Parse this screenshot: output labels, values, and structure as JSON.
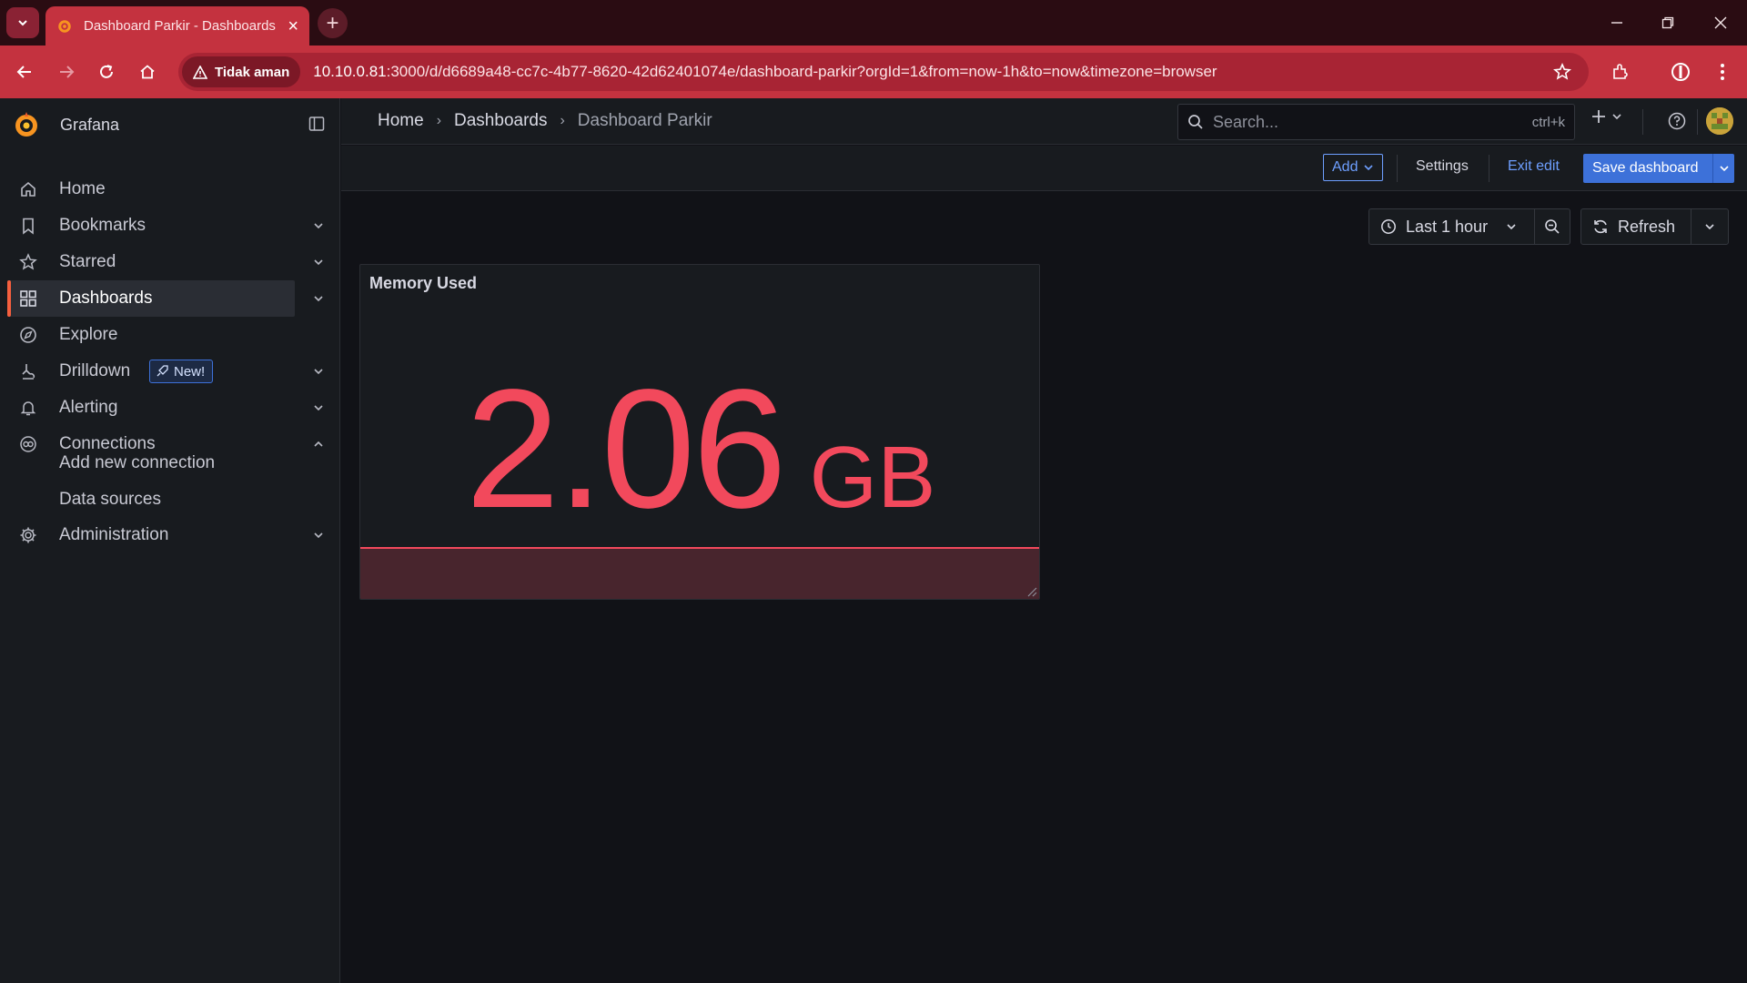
{
  "browser": {
    "tab_title": "Dashboard Parkir - Dashboards - Grafana",
    "security_label": "Tidak aman",
    "url_host": "10.10.0.81",
    "url_rest": ":3000/d/d6689a48-cc7c-4b77-8620-42d62401074e/dashboard-parkir?orgId=1&from=now-1h&to=now&timezone=browser"
  },
  "app": {
    "name": "Grafana"
  },
  "sidebar": {
    "items": [
      {
        "label": "Home",
        "icon": "home-icon"
      },
      {
        "label": "Bookmarks",
        "icon": "bookmark-icon"
      },
      {
        "label": "Starred",
        "icon": "star-icon"
      },
      {
        "label": "Dashboards",
        "icon": "apps-icon"
      },
      {
        "label": "Explore",
        "icon": "compass-icon"
      },
      {
        "label": "Drilldown",
        "icon": "drilldown-icon",
        "badge": "New!"
      },
      {
        "label": "Alerting",
        "icon": "bell-icon"
      },
      {
        "label": "Connections",
        "icon": "connections-icon"
      },
      {
        "label": "Administration",
        "icon": "gear-icon"
      }
    ],
    "connections_sub": [
      "Add new connection",
      "Data sources"
    ]
  },
  "breadcrumb": [
    "Home",
    "Dashboards",
    "Dashboard Parkir"
  ],
  "search": {
    "placeholder": "Search...",
    "shortcut": "ctrl+k"
  },
  "editbar": {
    "add_label": "Add",
    "settings_label": "Settings",
    "exit_label": "Exit edit",
    "save_label": "Save dashboard"
  },
  "controls": {
    "time_range": "Last 1 hour",
    "refresh_label": "Refresh"
  },
  "panel": {
    "title": "Memory Used",
    "value": "2.06",
    "unit": "GB",
    "color": "#f2495c"
  },
  "colors": {
    "accent": "#3d71d9",
    "active_marker": "#f55f3e",
    "stat_red": "#f2495c",
    "browser_theme": "#c4323f"
  }
}
